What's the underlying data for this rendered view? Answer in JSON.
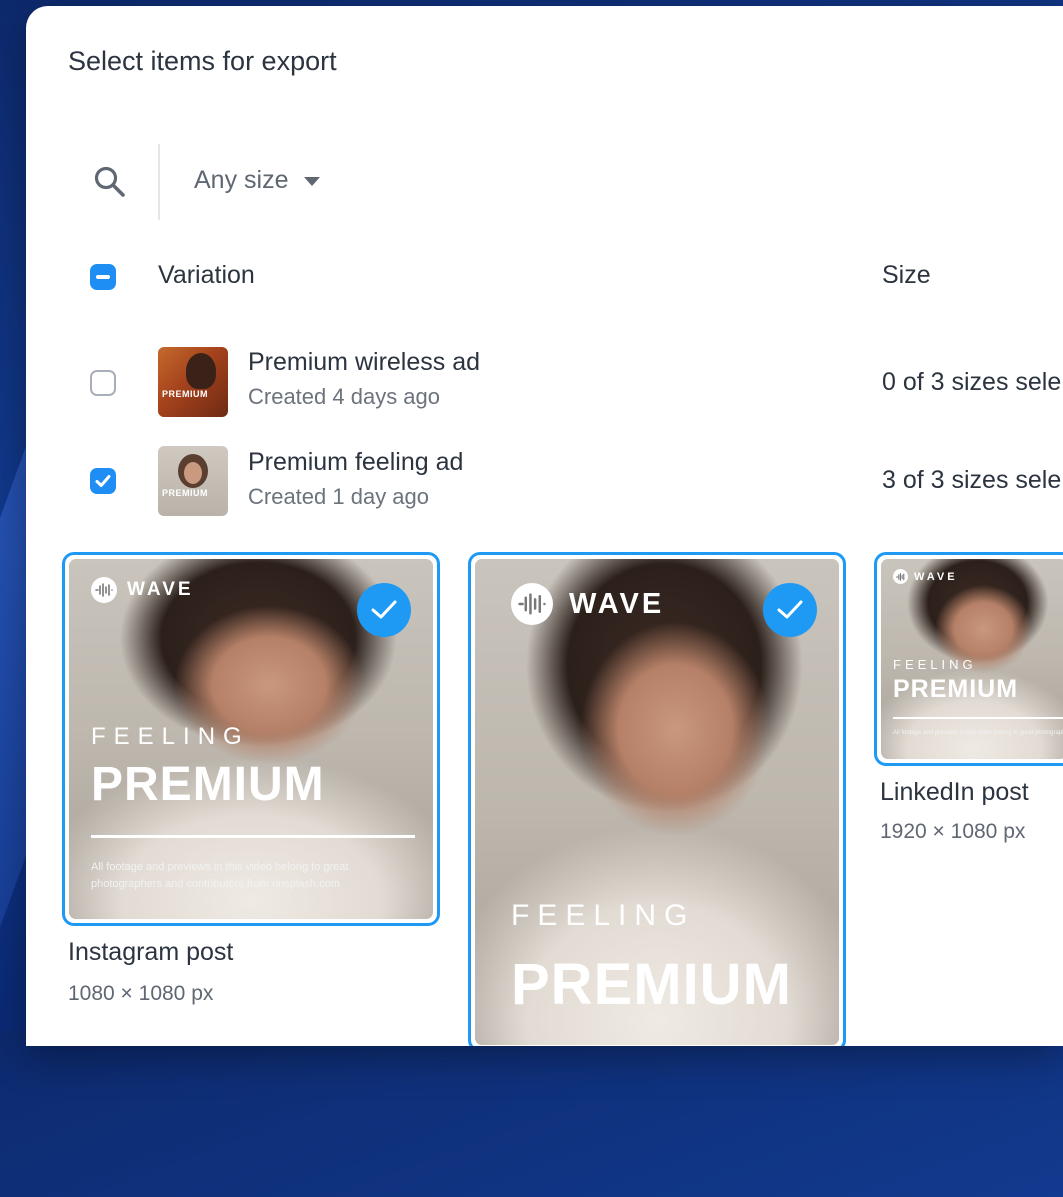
{
  "dialog": {
    "title": "Select items for export",
    "filter": {
      "size_label": "Any size"
    }
  },
  "table": {
    "headers": {
      "variation": "Variation",
      "size": "Size"
    },
    "rows": [
      {
        "name": "Premium wireless ad",
        "created": "Created 4 days ago",
        "size_status": "0 of 3 sizes sele",
        "checked": false,
        "thumb_text": "PREMIUM"
      },
      {
        "name": "Premium feeling ad",
        "created": "Created 1 day ago",
        "size_status": "3 of 3 sizes sele",
        "checked": true,
        "thumb_text": "PREMIUM"
      }
    ]
  },
  "cards": [
    {
      "label": "Instagram post",
      "dims": "1080 × 1080 px",
      "brand": "WAVE",
      "kicker": "FEELING",
      "headline": "PREMIUM",
      "credit": "All footage and previews in this video belong to great photographers and contributors from unsplash.com",
      "selected": true
    },
    {
      "label": "",
      "dims": "",
      "brand": "WAVE",
      "kicker": "FEELING",
      "headline": "PREMIUM",
      "selected": true
    },
    {
      "label": "LinkedIn post",
      "dims": "1920 × 1080 px",
      "brand": "WAVE",
      "kicker": "FEELING",
      "headline": "PREMIUM",
      "credit": "All footage and previews in this video belong to great photographers",
      "selected": true
    }
  ],
  "colors": {
    "accent": "#1e8ef5",
    "text": "#2c3440",
    "muted": "#6c737d"
  }
}
